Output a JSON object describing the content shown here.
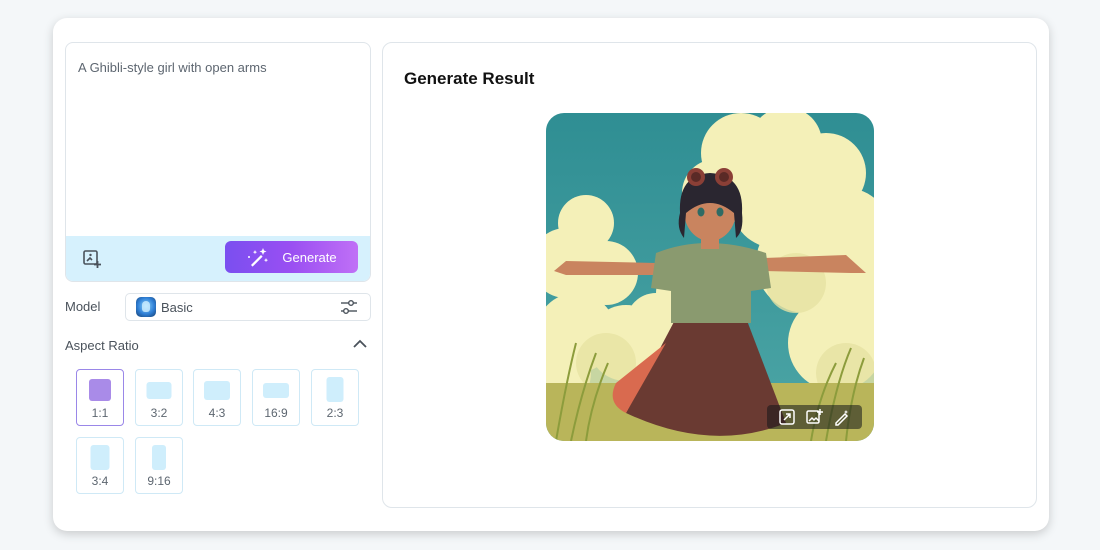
{
  "prompt": {
    "value": "A Ghibli-style girl with open arms",
    "generate_label": "Generate"
  },
  "model": {
    "label": "Model",
    "selected": "Basic"
  },
  "aspect_ratio": {
    "label": "Aspect Ratio",
    "options": [
      "1:1",
      "3:2",
      "4:3",
      "16:9",
      "2:3",
      "3:4",
      "9:16"
    ],
    "selected": "1:1"
  },
  "result": {
    "title": "Generate Result"
  },
  "colors": {
    "accent_start": "#7a4ff0",
    "accent_end": "#c070f6",
    "toolbar_bg": "#d6f1fd"
  },
  "icons": {
    "upload": "image-upload-icon",
    "generate": "magic-wand-icon",
    "settings": "sliders-icon",
    "collapse": "chevron-up-icon",
    "actions": [
      "upscale-icon",
      "save-image-icon",
      "edit-icon"
    ]
  }
}
